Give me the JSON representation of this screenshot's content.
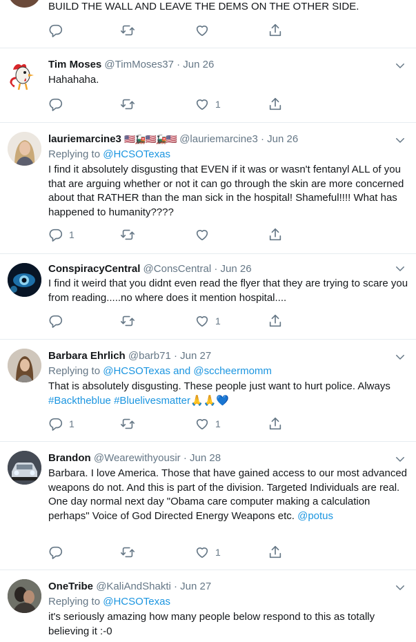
{
  "tweets": [
    {
      "body": "BUILD THE WALL AND LEAVE THE DEMS ON THE OTHER SIDE.",
      "replies": "",
      "likes": ""
    },
    {
      "name": "Tim Moses",
      "handle": "@TimMoses37",
      "date": "Jun 26",
      "avatar_icon": "rooster-avatar-icon",
      "body": "Hahahaha.",
      "replies": "",
      "likes": "1"
    },
    {
      "name": "lauriemarcine3",
      "flags": "🇺🇸🚂🇺🇸🚂🇺🇸",
      "handle": "@lauriemarcine3",
      "date": "Jun 26",
      "reply_prefix": "Replying to",
      "reply_to": "@HCSOTexas",
      "body": "I find it absolutely disgusting that EVEN if it was or wasn't fentanyl ALL of you that are arguing whether or not it can go through the skin are more concerned about that RATHER than the man sick in the hospital! Shameful!!!! What has happened to humanity????",
      "replies": "1",
      "likes": ""
    },
    {
      "name": "ConspiracyCentral",
      "handle": "@ConsCentral",
      "date": "Jun 26",
      "body": "I find it weird that you didnt even read the flyer that they are trying to scare you from reading.....no where does it mention hospital....",
      "replies": "",
      "likes": "1"
    },
    {
      "name": "Barbara Ehrlich",
      "handle": "@barb71",
      "date": "Jun 27",
      "reply_prefix": "Replying to",
      "reply_to": "@HCSOTexas",
      "reply_and": "and",
      "reply_to2": "@sccheermomm",
      "body": "That is absolutely disgusting. These people just want to hurt police. Always",
      "hashtags": "#Backtheblue #Bluelivesmatter",
      "emojis": "🙏🙏💙",
      "replies": "1",
      "likes": "1"
    },
    {
      "name": "Brandon",
      "handle": "@Wearewithyousir",
      "date": "Jun 28",
      "body": "Barbara. I love America. Those that have gained access to our most advanced weapons do not. And this is part of the division. Targeted Individuals are real. One day normal next day \"Obama care computer making a calculation perhaps\" Voice of God Directed Energy Weapons etc.",
      "mention": "@potus",
      "replies": "",
      "likes": "1"
    },
    {
      "name": "OneTribe",
      "handle": "@KaliAndShakti",
      "date": "Jun 27",
      "reply_prefix": "Replying to",
      "reply_to": "@HCSOTexas",
      "body": "it's seriously amazing how many people below respond to this as totally believing it :-0"
    }
  ],
  "colors": {
    "link": "#1b95e0",
    "muted": "#657786",
    "text": "#14171a",
    "divider": "#e6ecf0"
  }
}
